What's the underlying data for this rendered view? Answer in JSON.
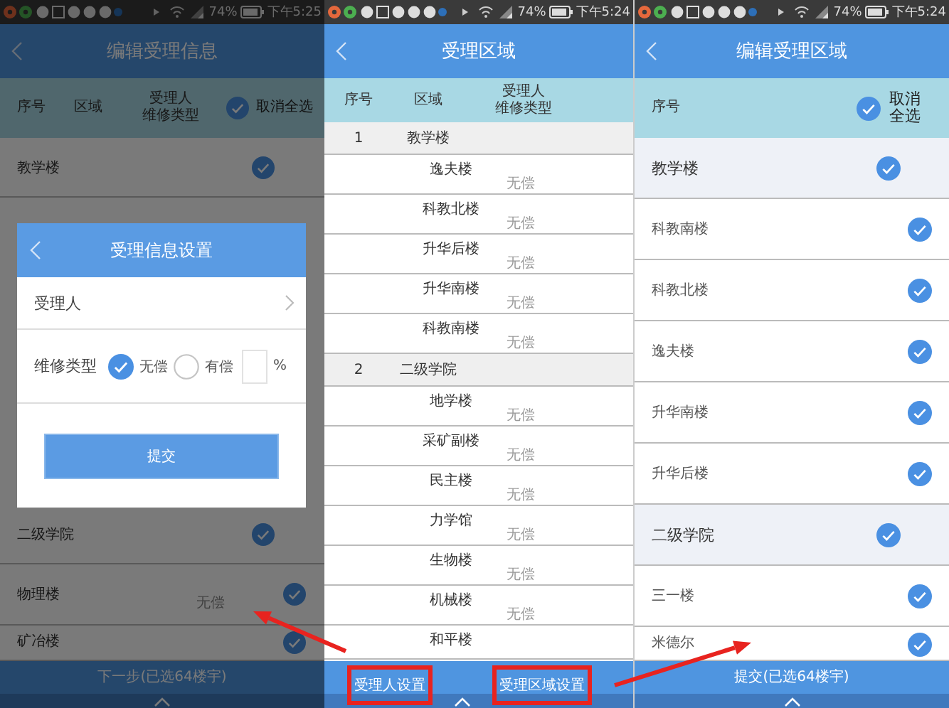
{
  "screens": [
    {
      "kind": "info_dialog",
      "status_bar": {
        "battery": "74%",
        "time": "下午5:25"
      },
      "title": "编辑受理信息",
      "columns": [
        {
          "lines": [
            "序号"
          ]
        },
        {
          "lines": [
            "区域"
          ]
        },
        {
          "lines": [
            "受理人",
            "维修类型"
          ]
        }
      ],
      "select_all": {
        "lines": [
          "取消全选"
        ],
        "checked": true
      },
      "rows": [
        {
          "kind": "group",
          "name": "教学楼",
          "checked": true
        },
        {
          "kind": "group",
          "name": "二级学院",
          "checked": true
        },
        {
          "kind": "item",
          "name": "物理楼",
          "repair_type": "无偿",
          "checked": true
        },
        {
          "kind": "item",
          "name": "矿冶楼",
          "checked": true
        }
      ],
      "dialog": {
        "title": "受理信息设置",
        "assignee_label": "受理人",
        "repair_type_label": "维修类型",
        "options": [
          {
            "label": "无偿",
            "selected": true
          },
          {
            "label": "有偿",
            "selected": false
          }
        ],
        "percent_unit": "%",
        "submit": "提交"
      },
      "footer": "下一步(已选64楼宇)"
    },
    {
      "kind": "area_list",
      "status_bar": {
        "battery": "74%",
        "time": "下午5:24"
      },
      "title": "受理区域",
      "columns": [
        {
          "lines": [
            "序号"
          ]
        },
        {
          "lines": [
            "区域"
          ]
        },
        {
          "lines": [
            "受理人",
            "维修类型"
          ]
        }
      ],
      "groups": [
        {
          "index": "1",
          "name": "教学楼",
          "items": [
            {
              "name": "逸夫楼",
              "repair_type": "无偿"
            },
            {
              "name": "科教北楼",
              "repair_type": "无偿"
            },
            {
              "name": "升华后楼",
              "repair_type": "无偿"
            },
            {
              "name": "升华南楼",
              "repair_type": "无偿"
            },
            {
              "name": "科教南楼",
              "repair_type": "无偿"
            }
          ]
        },
        {
          "index": "2",
          "name": "二级学院",
          "items": [
            {
              "name": "地学楼",
              "repair_type": "无偿"
            },
            {
              "name": "采矿副楼",
              "repair_type": "无偿"
            },
            {
              "name": "民主楼",
              "repair_type": "无偿"
            },
            {
              "name": "力学馆",
              "repair_type": "无偿"
            },
            {
              "name": "生物楼",
              "repair_type": "无偿"
            },
            {
              "name": "机械楼",
              "repair_type": "无偿"
            },
            {
              "name": "和平楼"
            }
          ]
        }
      ],
      "footer_buttons": [
        {
          "label": "受理人设置",
          "highlighted": true
        },
        {
          "label": "受理区域设置",
          "highlighted": true
        }
      ]
    },
    {
      "kind": "area_edit",
      "status_bar": {
        "battery": "74%",
        "time": "下午5:24"
      },
      "title": "编辑受理区域",
      "columns": [
        {
          "lines": [
            "序号"
          ]
        }
      ],
      "select_all": {
        "lines": [
          "取消",
          "全选"
        ],
        "checked": true
      },
      "rows": [
        {
          "kind": "group",
          "name": "教学楼",
          "checked": true
        },
        {
          "kind": "item",
          "name": "科教南楼",
          "checked": true
        },
        {
          "kind": "item",
          "name": "科教北楼",
          "checked": true
        },
        {
          "kind": "item",
          "name": "逸夫楼",
          "checked": true
        },
        {
          "kind": "item",
          "name": "升华南楼",
          "checked": true
        },
        {
          "kind": "item",
          "name": "升华后楼",
          "checked": true
        },
        {
          "kind": "group",
          "name": "二级学院",
          "checked": true
        },
        {
          "kind": "item",
          "name": "三一楼",
          "checked": true
        },
        {
          "kind": "item",
          "name": "米德尔",
          "checked": true
        }
      ],
      "footer": "提交(已选64楼宇)"
    }
  ]
}
